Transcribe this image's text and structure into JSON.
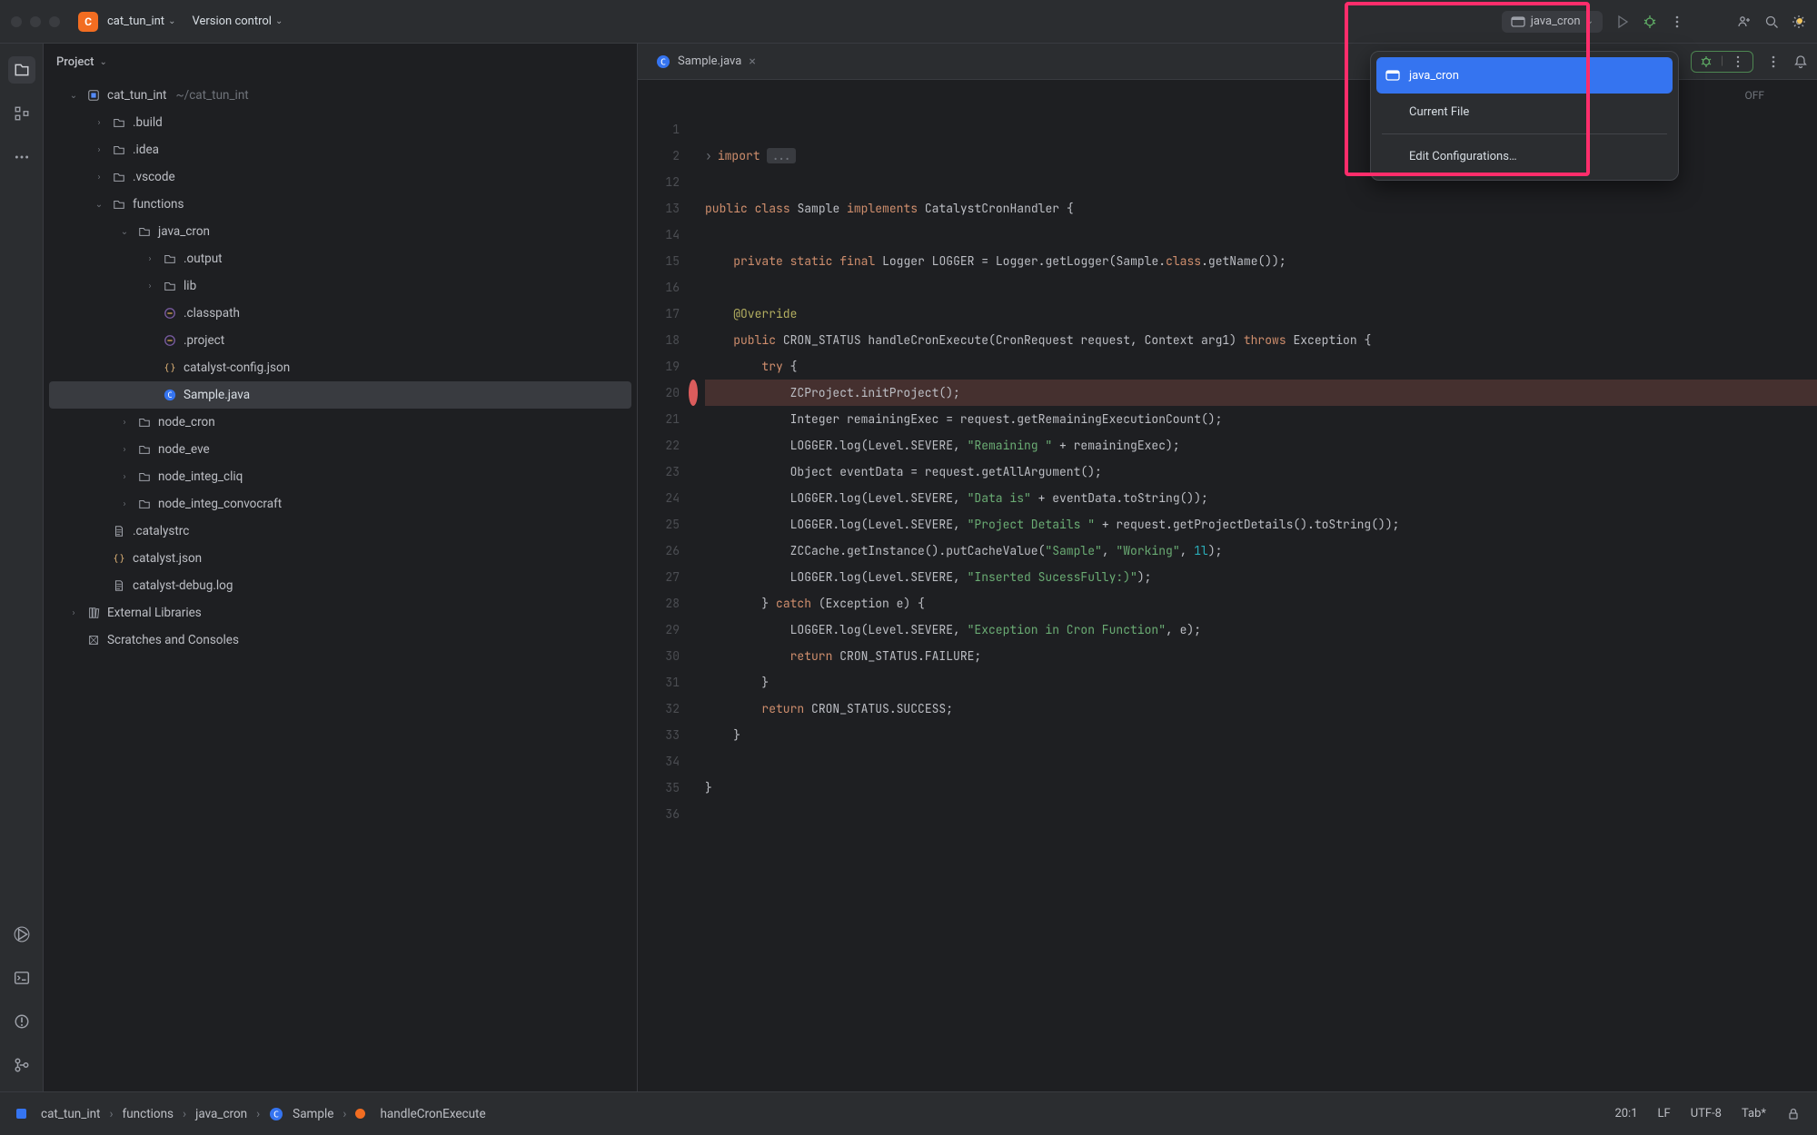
{
  "titlebar": {
    "project_badge_letter": "C",
    "project_name": "cat_tun_int",
    "vcs_label": "Version control"
  },
  "run": {
    "config_name": "java_cron",
    "dropdown": {
      "items": [
        {
          "label": "java_cron",
          "selected": true
        },
        {
          "label": "Current File",
          "selected": false
        }
      ],
      "edit_label": "Edit Configurations…"
    }
  },
  "project_panel": {
    "title": "Project"
  },
  "tree": [
    {
      "depth": 0,
      "twisty": "v",
      "icon": "module",
      "label": "cat_tun_int",
      "suffix": "~/cat_tun_int"
    },
    {
      "depth": 1,
      "twisty": ">",
      "icon": "folder",
      "label": ".build"
    },
    {
      "depth": 1,
      "twisty": ">",
      "icon": "folder",
      "label": ".idea"
    },
    {
      "depth": 1,
      "twisty": ">",
      "icon": "folder",
      "label": ".vscode"
    },
    {
      "depth": 1,
      "twisty": "v",
      "icon": "folder",
      "label": "functions"
    },
    {
      "depth": 2,
      "twisty": "v",
      "icon": "folder",
      "label": "java_cron"
    },
    {
      "depth": 3,
      "twisty": ">",
      "icon": "folder",
      "label": ".output"
    },
    {
      "depth": 3,
      "twisty": ">",
      "icon": "folder",
      "label": "lib"
    },
    {
      "depth": 3,
      "twisty": "",
      "icon": "eclipse",
      "label": ".classpath"
    },
    {
      "depth": 3,
      "twisty": "",
      "icon": "eclipse",
      "label": ".project"
    },
    {
      "depth": 3,
      "twisty": "",
      "icon": "json",
      "label": "catalyst-config.json"
    },
    {
      "depth": 3,
      "twisty": "",
      "icon": "java",
      "label": "Sample.java",
      "selected": true
    },
    {
      "depth": 2,
      "twisty": ">",
      "icon": "folder",
      "label": "node_cron"
    },
    {
      "depth": 2,
      "twisty": ">",
      "icon": "folder",
      "label": "node_eve"
    },
    {
      "depth": 2,
      "twisty": ">",
      "icon": "folder",
      "label": "node_integ_cliq"
    },
    {
      "depth": 2,
      "twisty": ">",
      "icon": "folder",
      "label": "node_integ_convocraft"
    },
    {
      "depth": 1,
      "twisty": "",
      "icon": "file",
      "label": ".catalystrc"
    },
    {
      "depth": 1,
      "twisty": "",
      "icon": "json",
      "label": "catalyst.json"
    },
    {
      "depth": 1,
      "twisty": "",
      "icon": "file",
      "label": "catalyst-debug.log"
    },
    {
      "depth": 0,
      "twisty": ">",
      "icon": "lib",
      "label": "External Libraries"
    },
    {
      "depth": 0,
      "twisty": "",
      "icon": "scratch",
      "label": "Scratches and Consoles"
    }
  ],
  "editor": {
    "tab_title": "Sample.java",
    "off_label": "OFF",
    "line_numbers": [
      1,
      2,
      12,
      13,
      14,
      15,
      16,
      17,
      18,
      19,
      20,
      21,
      22,
      23,
      24,
      25,
      26,
      27,
      28,
      29,
      30,
      31,
      32,
      33,
      34,
      35,
      36
    ],
    "breakpoint_line": 20
  },
  "breadcrumb": {
    "items": [
      "cat_tun_int",
      "functions",
      "java_cron",
      "Sample",
      "handleCronExecute"
    ]
  },
  "statusbar": {
    "position": "20:1",
    "line_sep": "LF",
    "encoding": "UTF-8",
    "indent": "Tab*"
  },
  "code_tokens": {
    "import": "import",
    "public": "public",
    "class": "class",
    "implements": "implements",
    "private": "private",
    "static": "static",
    "final": "final",
    "return": "return",
    "throws": "throws",
    "try": "try",
    "catch": "catch",
    "class_kw": "class",
    "override": "@Override",
    "s_remaining": "\"Remaining \"",
    "s_datais": "\"Data is\"",
    "s_project": "\"Project Details \"",
    "s_sample": "\"Sample\"",
    "s_working": "\"Working\"",
    "s_inserted": "\"Inserted SucessFully:)\"",
    "s_exception": "\"Exception in Cron Function\"",
    "n_1l": "1l"
  }
}
